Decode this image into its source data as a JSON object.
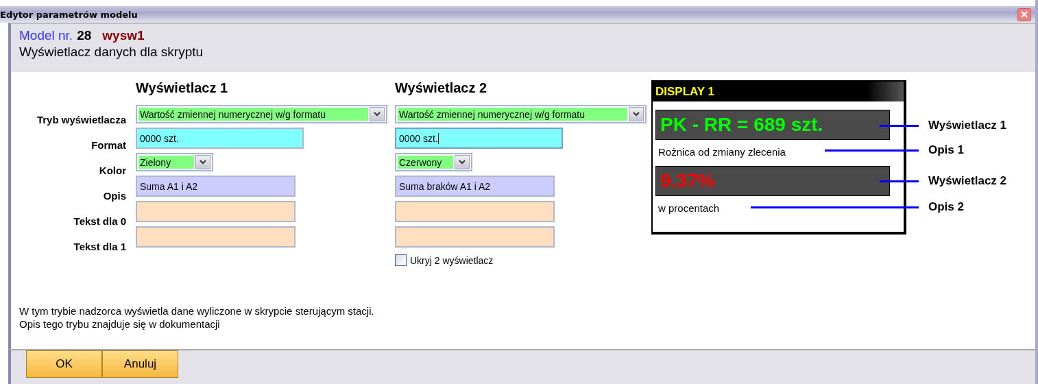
{
  "window": {
    "title": "Edytor parametrów modelu"
  },
  "header": {
    "model_label": "Model nr.",
    "model_number": "28",
    "model_name": "wysw1",
    "subtitle": "Wyświetlacz danych dla skryptu"
  },
  "form_labels": [
    "Tryb wyświetlacza",
    "Format",
    "Kolor",
    "Opis",
    "Tekst dla 0",
    "Tekst dla 1"
  ],
  "displays": [
    {
      "heading": "Wyświetlacz 1",
      "mode": "Wartość zmiennej numerycznej w/g formatu",
      "format": "0000 szt.",
      "color_name": "Zielony",
      "description": "Suma A1 i A2",
      "focused": false
    },
    {
      "heading": "Wyświetlacz 2",
      "mode": "Wartość zmiennej numerycznej w/g formatu",
      "format": "0000 szt.",
      "color_name": "Czerwony",
      "description": "Suma braków A1 i A2",
      "focused": true
    }
  ],
  "hide_second": {
    "label": "Ukryj 2 wyświetlacz",
    "checked": false
  },
  "preview": {
    "title": "DISPLAY 1",
    "items": [
      {
        "value": "PK - RR = 689 szt.",
        "color": "#00ff00",
        "description": "Rożnica od zmiany zlecenia"
      },
      {
        "value": "9.37%",
        "color": "#ff0000",
        "description": "w procentach"
      }
    ]
  },
  "annotations": [
    "Wyświetlacz 1",
    "Opis 1",
    "Wyświetlacz 2",
    "Opis 2"
  ],
  "info": [
    "W tym trybie nadzorca wyświetla dane wyliczone w skrypcie sterującym stacji.",
    "Opis tego trybu znajduje się w dokumentacji"
  ],
  "buttons": [
    "OK",
    "Anuluj"
  ]
}
